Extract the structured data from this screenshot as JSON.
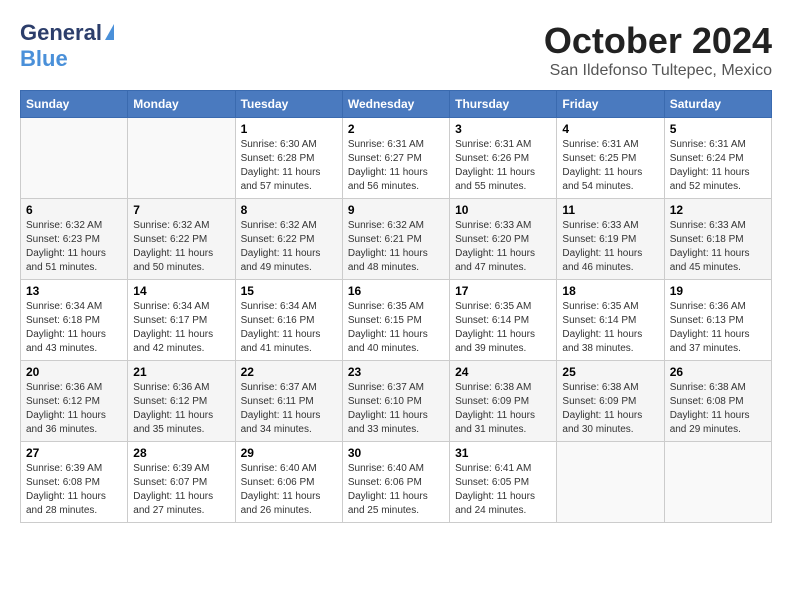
{
  "logo": {
    "line1": "General",
    "line2": "Blue"
  },
  "title": "October 2024",
  "subtitle": "San Ildefonso Tultepec, Mexico",
  "days_of_week": [
    "Sunday",
    "Monday",
    "Tuesday",
    "Wednesday",
    "Thursday",
    "Friday",
    "Saturday"
  ],
  "weeks": [
    [
      {
        "day": "",
        "info": ""
      },
      {
        "day": "",
        "info": ""
      },
      {
        "day": "1",
        "info": "Sunrise: 6:30 AM\nSunset: 6:28 PM\nDaylight: 11 hours and 57 minutes."
      },
      {
        "day": "2",
        "info": "Sunrise: 6:31 AM\nSunset: 6:27 PM\nDaylight: 11 hours and 56 minutes."
      },
      {
        "day": "3",
        "info": "Sunrise: 6:31 AM\nSunset: 6:26 PM\nDaylight: 11 hours and 55 minutes."
      },
      {
        "day": "4",
        "info": "Sunrise: 6:31 AM\nSunset: 6:25 PM\nDaylight: 11 hours and 54 minutes."
      },
      {
        "day": "5",
        "info": "Sunrise: 6:31 AM\nSunset: 6:24 PM\nDaylight: 11 hours and 52 minutes."
      }
    ],
    [
      {
        "day": "6",
        "info": "Sunrise: 6:32 AM\nSunset: 6:23 PM\nDaylight: 11 hours and 51 minutes."
      },
      {
        "day": "7",
        "info": "Sunrise: 6:32 AM\nSunset: 6:22 PM\nDaylight: 11 hours and 50 minutes."
      },
      {
        "day": "8",
        "info": "Sunrise: 6:32 AM\nSunset: 6:22 PM\nDaylight: 11 hours and 49 minutes."
      },
      {
        "day": "9",
        "info": "Sunrise: 6:32 AM\nSunset: 6:21 PM\nDaylight: 11 hours and 48 minutes."
      },
      {
        "day": "10",
        "info": "Sunrise: 6:33 AM\nSunset: 6:20 PM\nDaylight: 11 hours and 47 minutes."
      },
      {
        "day": "11",
        "info": "Sunrise: 6:33 AM\nSunset: 6:19 PM\nDaylight: 11 hours and 46 minutes."
      },
      {
        "day": "12",
        "info": "Sunrise: 6:33 AM\nSunset: 6:18 PM\nDaylight: 11 hours and 45 minutes."
      }
    ],
    [
      {
        "day": "13",
        "info": "Sunrise: 6:34 AM\nSunset: 6:18 PM\nDaylight: 11 hours and 43 minutes."
      },
      {
        "day": "14",
        "info": "Sunrise: 6:34 AM\nSunset: 6:17 PM\nDaylight: 11 hours and 42 minutes."
      },
      {
        "day": "15",
        "info": "Sunrise: 6:34 AM\nSunset: 6:16 PM\nDaylight: 11 hours and 41 minutes."
      },
      {
        "day": "16",
        "info": "Sunrise: 6:35 AM\nSunset: 6:15 PM\nDaylight: 11 hours and 40 minutes."
      },
      {
        "day": "17",
        "info": "Sunrise: 6:35 AM\nSunset: 6:14 PM\nDaylight: 11 hours and 39 minutes."
      },
      {
        "day": "18",
        "info": "Sunrise: 6:35 AM\nSunset: 6:14 PM\nDaylight: 11 hours and 38 minutes."
      },
      {
        "day": "19",
        "info": "Sunrise: 6:36 AM\nSunset: 6:13 PM\nDaylight: 11 hours and 37 minutes."
      }
    ],
    [
      {
        "day": "20",
        "info": "Sunrise: 6:36 AM\nSunset: 6:12 PM\nDaylight: 11 hours and 36 minutes."
      },
      {
        "day": "21",
        "info": "Sunrise: 6:36 AM\nSunset: 6:12 PM\nDaylight: 11 hours and 35 minutes."
      },
      {
        "day": "22",
        "info": "Sunrise: 6:37 AM\nSunset: 6:11 PM\nDaylight: 11 hours and 34 minutes."
      },
      {
        "day": "23",
        "info": "Sunrise: 6:37 AM\nSunset: 6:10 PM\nDaylight: 11 hours and 33 minutes."
      },
      {
        "day": "24",
        "info": "Sunrise: 6:38 AM\nSunset: 6:09 PM\nDaylight: 11 hours and 31 minutes."
      },
      {
        "day": "25",
        "info": "Sunrise: 6:38 AM\nSunset: 6:09 PM\nDaylight: 11 hours and 30 minutes."
      },
      {
        "day": "26",
        "info": "Sunrise: 6:38 AM\nSunset: 6:08 PM\nDaylight: 11 hours and 29 minutes."
      }
    ],
    [
      {
        "day": "27",
        "info": "Sunrise: 6:39 AM\nSunset: 6:08 PM\nDaylight: 11 hours and 28 minutes."
      },
      {
        "day": "28",
        "info": "Sunrise: 6:39 AM\nSunset: 6:07 PM\nDaylight: 11 hours and 27 minutes."
      },
      {
        "day": "29",
        "info": "Sunrise: 6:40 AM\nSunset: 6:06 PM\nDaylight: 11 hours and 26 minutes."
      },
      {
        "day": "30",
        "info": "Sunrise: 6:40 AM\nSunset: 6:06 PM\nDaylight: 11 hours and 25 minutes."
      },
      {
        "day": "31",
        "info": "Sunrise: 6:41 AM\nSunset: 6:05 PM\nDaylight: 11 hours and 24 minutes."
      },
      {
        "day": "",
        "info": ""
      },
      {
        "day": "",
        "info": ""
      }
    ]
  ]
}
